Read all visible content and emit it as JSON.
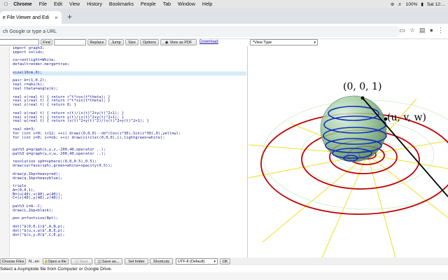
{
  "menubar": {
    "apple": "",
    "app": "Chrome",
    "items": [
      "File",
      "Edit",
      "View",
      "History",
      "Bookmarks",
      "People",
      "Tab",
      "Window",
      "Help"
    ],
    "battery": "100%",
    "clock": "Sat 12:..."
  },
  "tab": {
    "title": "e File Viewer and Edi",
    "close": "×",
    "new": "+"
  },
  "omnibox": {
    "placeholder": "ch Google or type a URL"
  },
  "appbar": {
    "find": "Find",
    "replace": "Replace",
    "jump": "Jump",
    "size": "Size",
    "options": "Options",
    "view_pdf": "View as PDF",
    "download": "Download",
    "view_type": "*View Type"
  },
  "editor": {
    "lines": [
      "import graph3;",
      "import solids;",
      "",
      "currentlight=White;",
      "defaultrender.merge=true;",
      "",
      "size(10cm,0);",
      "",
      "pair k=(1,0.2);",
      "real r=abs(k);",
      "real theta=angle(k);",
      "",
      "real x(real t) { return r^t*cos(t*theta); }",
      "real y(real t) { return r^t*sin(t*theta); }",
      "real z(real t) { return 0; }",
      "",
      "real u(real t) { return x(t)/(x(t)^2+y(t)^2+1); }",
      "real v(real t) { return y(t)/(x(t)^2+y(t)^2+1); }",
      "real w(real t) { return (x(t)^2+y(t)^2)/(x(t)^2+y(t)^2+1); }",
      "",
      "real nb=3;",
      "for (int i=0; i<12; ++i) draw((0,0,0)--nb*(Cos(i*30),Sin(i*30),0),yellow);",
      "for (int i=0; i<=nb; ++i) draw(circle((0,0,0),i),lightgreen+white);",
      "",
      "",
      "path3 p=graph(x,y,z,-200,40,operator ..);",
      "path3 q=graph(u,v,w,-200,40,operator ..);",
      "",
      "revolution sph=sphere((0,0,0.5),0.5);",
      "draw(surface(sph),green+white+opacity(0.5));",
      "",
      "draw(p,1bp+heavyred);",
      "draw(q,1bp+heavyblue);",
      "",
      "triple",
      "A=(0,0,1),",
      "B=(u(40),v(40),w(40)),",
      "C=(x(40),y(40),z(40));",
      "",
      "path3 L=A--C;",
      "draw(L,1bp+black);",
      "",
      "pen p=fontsize(8pt);",
      "",
      "dot(\"$(0,0,1)$\",A,N,p);",
      "dot(\"$(u,v,w)$\",B,E,p);",
      "dot(\"$(x,y,0)$\",C,E,p);"
    ],
    "highlight_line": 7
  },
  "viewer": {
    "label_a": "(0, 0, 1)",
    "label_b": "(u, v, w)"
  },
  "bottombar": {
    "choose": "Choose Files",
    "no_file": "N...en",
    "open_file": "Open a file",
    "save": "Save",
    "save_as": "Save as...",
    "set_folder": "Set folder",
    "shortcuts": "Shortcuts",
    "encoding": "UTF-8 (Default)",
    "ok": "OK"
  },
  "status": "Select a Asymptote file from Computer or Google Drive.",
  "colors": {
    "accent": "#1a73e8",
    "red_curve": "#c00000",
    "blue_curve": "#1030c0",
    "sphere": "#8fbf8f",
    "grid": "#f0e020"
  }
}
